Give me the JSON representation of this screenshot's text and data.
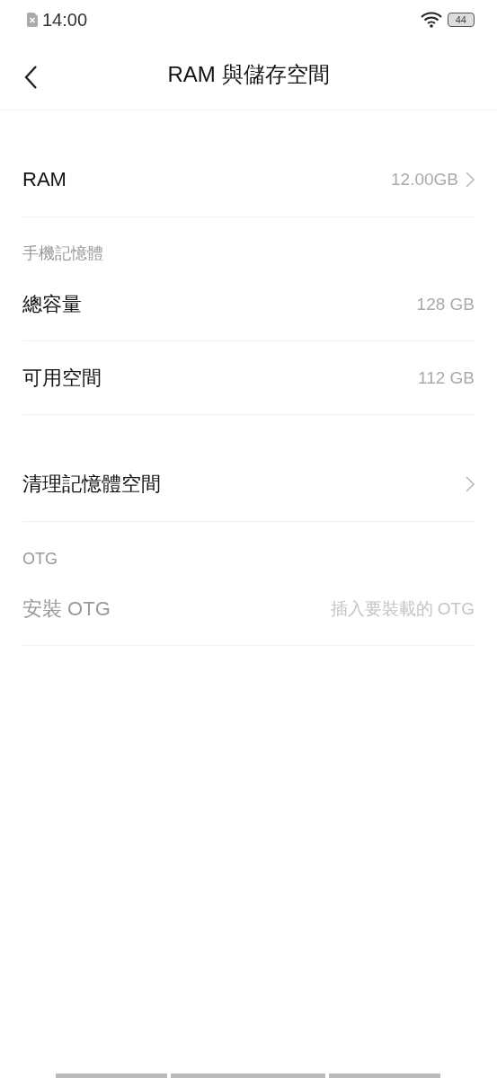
{
  "status_bar": {
    "time": "14:00",
    "battery": "44"
  },
  "header": {
    "title": "RAM 與儲存空間"
  },
  "sections": [
    {
      "items": [
        {
          "label": "RAM",
          "value": "12.00GB",
          "chevron": true,
          "disabled": false
        }
      ]
    },
    {
      "title": "手機記憶體",
      "items": [
        {
          "label": "總容量",
          "value": "128 GB",
          "chevron": false,
          "disabled": false
        },
        {
          "label": "可用空間",
          "value": "112 GB",
          "chevron": false,
          "disabled": false
        }
      ]
    },
    {
      "items": [
        {
          "label": "清理記憶體空間",
          "chevron": true,
          "disabled": false
        }
      ]
    },
    {
      "title": "OTG",
      "items": [
        {
          "label": "安裝 OTG",
          "value": "插入要裝載的 OTG",
          "chevron": false,
          "disabled": true
        }
      ]
    }
  ]
}
